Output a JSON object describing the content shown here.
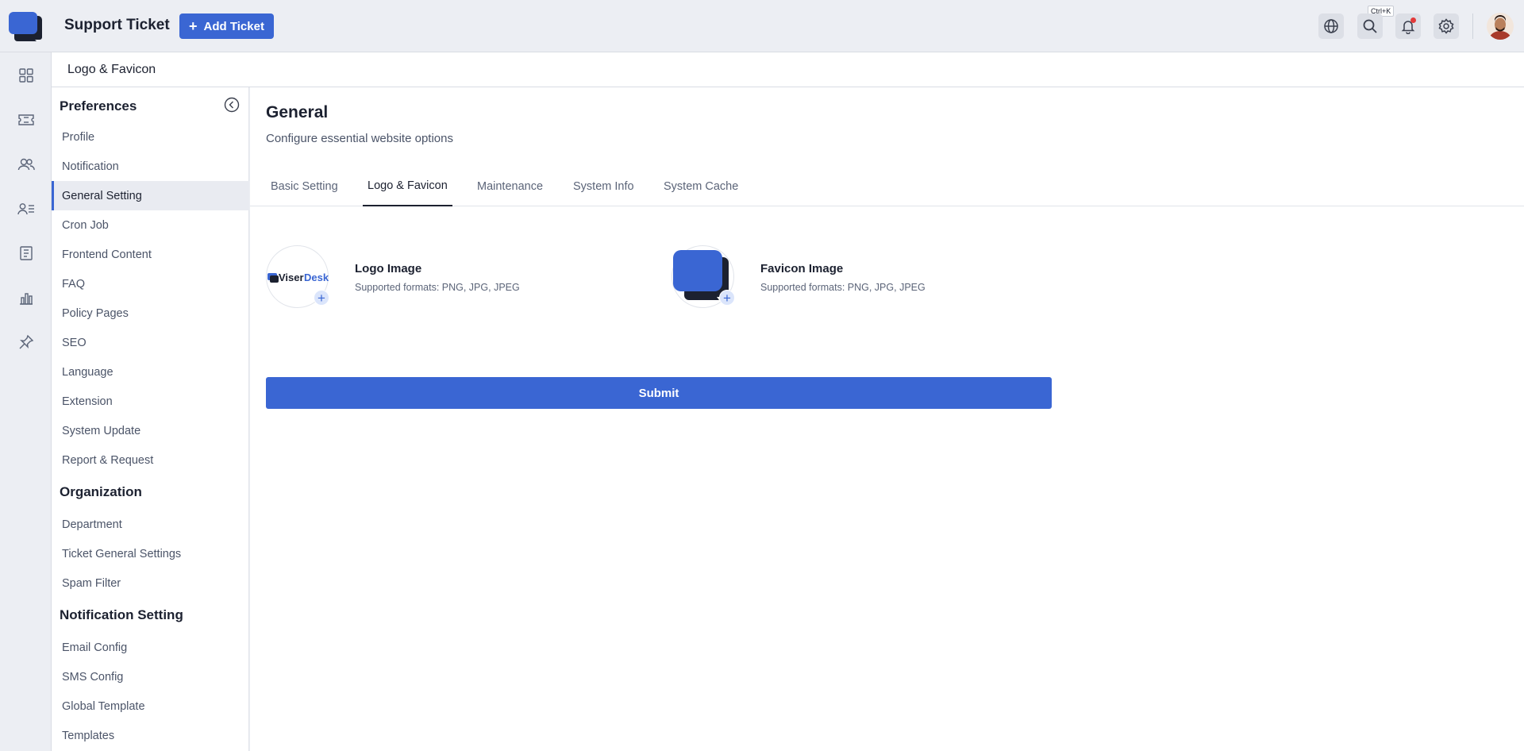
{
  "app": {
    "title": "Support Ticket",
    "add_button_label": "Add Ticket",
    "search_shortcut": "Ctrl+K",
    "accent_color": "#3a66d3"
  },
  "topbar_icons": [
    "globe-icon",
    "search-icon",
    "bell-icon",
    "gear-icon"
  ],
  "rail_icons": [
    "dashboard-icon",
    "ticket-icon",
    "users-icon",
    "user-list-icon",
    "document-icon",
    "chart-icon",
    "pin-icon"
  ],
  "breadcrumb": "Logo & Favicon",
  "sidebar": {
    "sections": [
      {
        "heading": "Preferences",
        "items": [
          "Profile",
          "Notification",
          "General Setting",
          "Cron Job",
          "Frontend Content",
          "FAQ",
          "Policy Pages",
          "SEO",
          "Language",
          "Extension",
          "System Update",
          "Report & Request"
        ]
      },
      {
        "heading": "Organization",
        "items": [
          "Department",
          "Ticket General Settings",
          "Spam Filter"
        ]
      },
      {
        "heading": "Notification Setting",
        "items": [
          "Email Config",
          "SMS Config",
          "Global Template",
          "Templates"
        ]
      }
    ],
    "active_item": "General Setting"
  },
  "main": {
    "title": "General",
    "subtitle": "Configure essential website options",
    "tabs": [
      "Basic Setting",
      "Logo & Favicon",
      "Maintenance",
      "System Info",
      "System Cache"
    ],
    "active_tab": "Logo & Favicon",
    "logo": {
      "title": "Logo Image",
      "formats": "Supported formats: PNG, JPG, JPEG",
      "brand_text_1": "Viser",
      "brand_text_2": "Desk"
    },
    "favicon": {
      "title": "Favicon Image",
      "formats": "Supported formats: PNG, JPG, JPEG"
    },
    "submit_label": "Submit"
  }
}
